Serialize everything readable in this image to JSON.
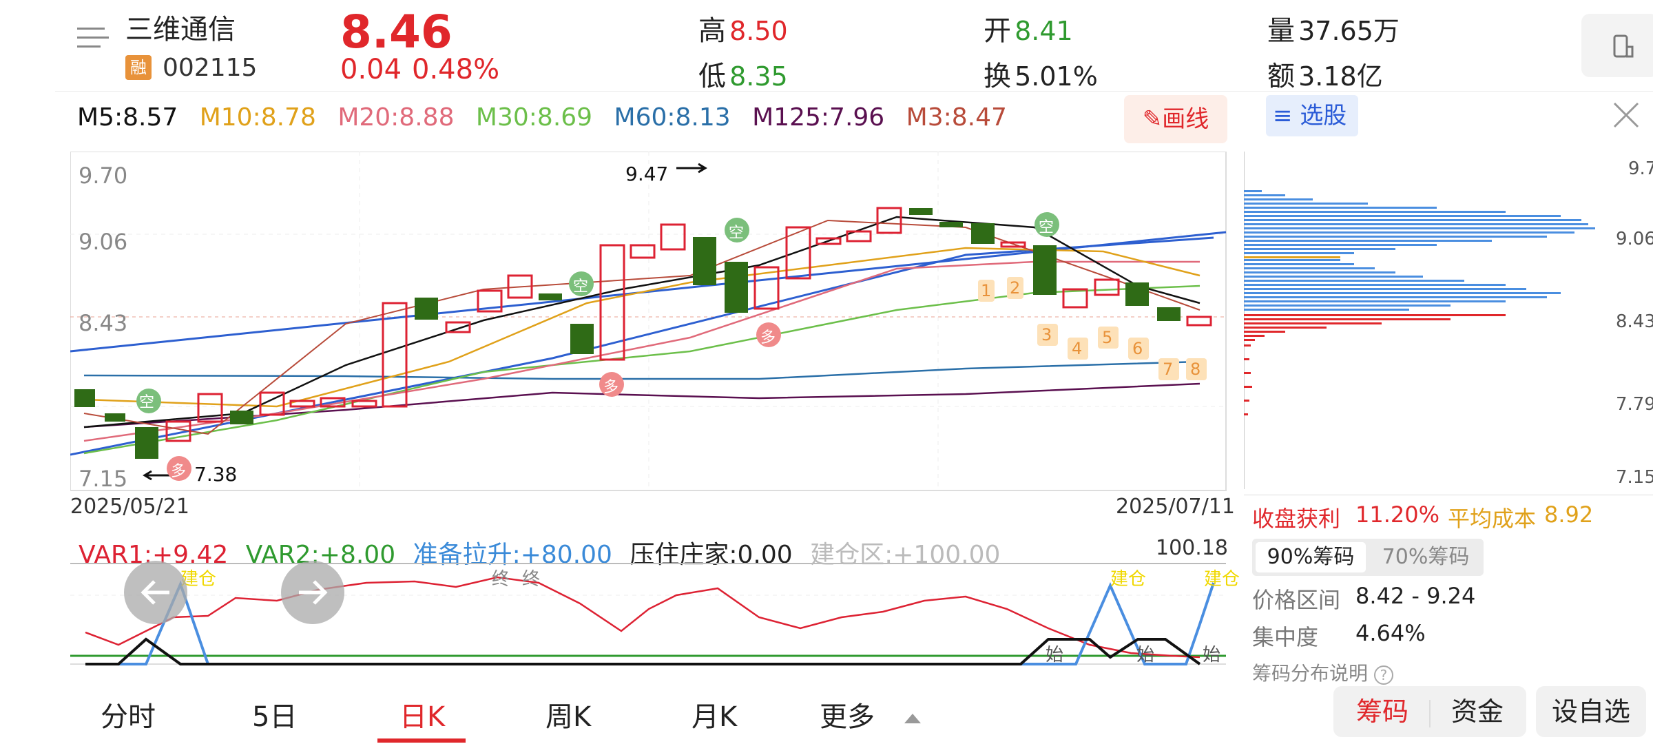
{
  "header": {
    "stock_name": "三维通信",
    "rong_badge": "融",
    "code": "002115",
    "price": "8.46",
    "change": "0.04",
    "change_pct": "0.48%",
    "high_label": "高",
    "high": "8.50",
    "low_label": "低",
    "low": "8.35",
    "open_label": "开",
    "open": "8.41",
    "turnover_label": "换",
    "turnover": "5.01%",
    "volume_label": "量",
    "volume": "37.65万",
    "amount_label": "额",
    "amount": "3.18亿"
  },
  "ma_bar": {
    "m5": "M5:8.57",
    "m10": "M10:8.78",
    "m20": "M20:8.88",
    "m30": "M30:8.69",
    "m60": "M60:8.13",
    "m125": "M125:7.96",
    "m3": "M3:8.47"
  },
  "draw_button": "画线",
  "chart": {
    "y_labels": [
      "9.70",
      "9.06",
      "8.43",
      "7.79",
      "7.15"
    ],
    "start_date": "2025/05/21",
    "end_date": "2025/07/11",
    "high_annotation": "9.47",
    "low_annotation": "7.38",
    "kong_label": "空",
    "duo_label": "多",
    "count_labels": [
      "1",
      "2",
      "3",
      "4",
      "5",
      "6",
      "7",
      "8"
    ]
  },
  "indicator": {
    "var1": "VAR1:+9.42",
    "var2": "VAR2:+8.00",
    "zhunbei": "准备拉升:+80.00",
    "yazhu": "压住庄家:0.00",
    "jiancangqu": "建仓区:+100.00",
    "max": "100.18",
    "jiancang": "建仓",
    "zhong": "终",
    "shi": "始"
  },
  "right_panel": {
    "xuangu": "选股",
    "price_labels": [
      "9.7",
      "9.06",
      "8.43",
      "7.79",
      "7.15"
    ],
    "profit_label": "收盘获利",
    "profit": "11.20%",
    "avg_cost_label": "平均成本",
    "avg_cost": "8.92",
    "chip90": "90%筹码",
    "chip70": "70%筹码",
    "range_label": "价格区间",
    "range": "8.42 - 9.24",
    "conc_label": "集中度",
    "conc": "4.64%",
    "explain": "筹码分布说明"
  },
  "nav": {
    "tabs": [
      "分时",
      "5日",
      "日K",
      "周K",
      "月K",
      "更多"
    ],
    "active": "日K"
  },
  "bottom_buttons": {
    "chouma": "筹码",
    "zijin": "资金",
    "zixuan": "设自选"
  },
  "colors": {
    "up": "#e0272b",
    "down": "#2f6b16",
    "accent": "#2a5bd7"
  }
}
